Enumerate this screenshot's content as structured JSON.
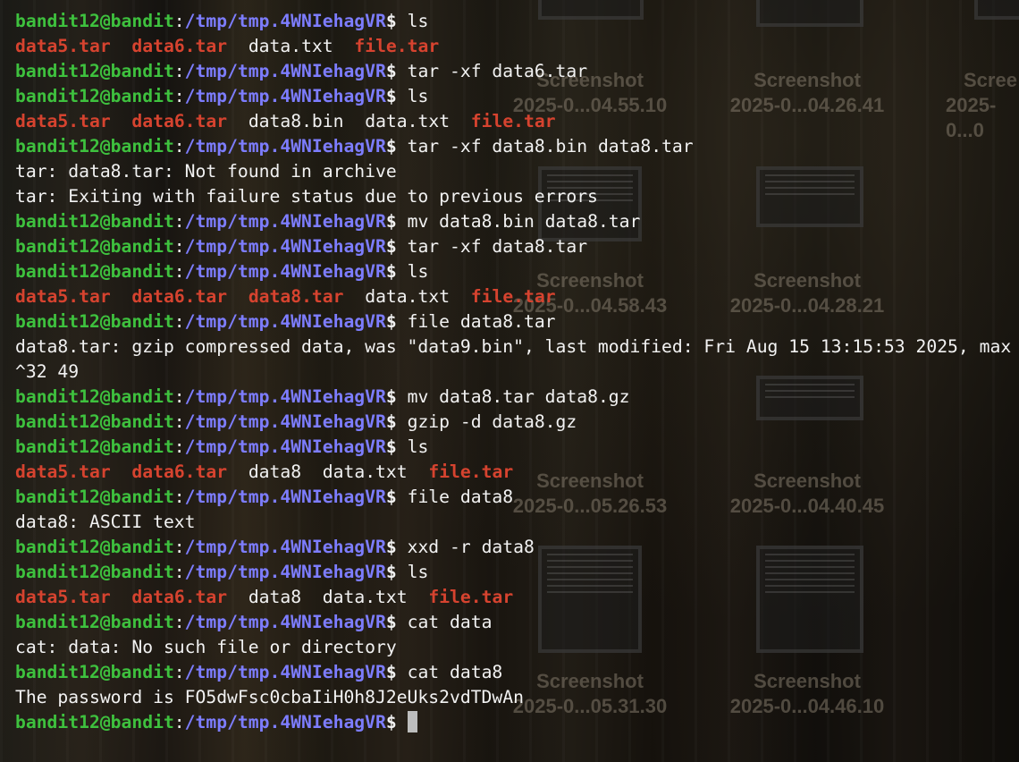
{
  "prompt": {
    "user_host": "bandit12@bandit",
    "sep": ":",
    "path": "/tmp/tmp.4WNIehagVR",
    "dollar": "$ "
  },
  "desktop": {
    "icons": [
      {
        "name": "Screenshot",
        "date": "2025-0...04.55.10"
      },
      {
        "name": "Screenshot",
        "date": "2025-0...04.26.41"
      },
      {
        "name": "Scree",
        "date": "2025-0...0"
      },
      {
        "name": "Screenshot",
        "date": "2025-0...04.58.43"
      },
      {
        "name": "Screenshot",
        "date": "2025-0...04.28.21"
      },
      {
        "name": "Screenshot",
        "date": "2025-0...05.26.53"
      },
      {
        "name": "Screenshot",
        "date": "2025-0...04.40.45"
      },
      {
        "name": "Screenshot",
        "date": "2025-0...05.31.30"
      },
      {
        "name": "Screenshot",
        "date": "2025-0...04.46.10"
      }
    ]
  },
  "terminal": {
    "lines": [
      {
        "type": "cmd",
        "text": "ls"
      },
      {
        "type": "ls",
        "items": [
          {
            "t": "data5.tar",
            "c": "red"
          },
          {
            "t": "data6.tar",
            "c": "red"
          },
          {
            "t": "data.txt",
            "c": "out"
          },
          {
            "t": "file.tar",
            "c": "red"
          }
        ]
      },
      {
        "type": "cmd",
        "text": "tar -xf data6.tar"
      },
      {
        "type": "cmd",
        "text": "ls"
      },
      {
        "type": "ls",
        "items": [
          {
            "t": "data5.tar",
            "c": "red"
          },
          {
            "t": "data6.tar",
            "c": "red"
          },
          {
            "t": "data8.bin",
            "c": "out"
          },
          {
            "t": "data.txt",
            "c": "out"
          },
          {
            "t": "file.tar",
            "c": "red"
          }
        ]
      },
      {
        "type": "cmd",
        "text": "tar -xf data8.bin data8.tar"
      },
      {
        "type": "out",
        "text": "tar: data8.tar: Not found in archive"
      },
      {
        "type": "out",
        "text": "tar: Exiting with failure status due to previous errors"
      },
      {
        "type": "cmd",
        "text": "mv data8.bin data8.tar"
      },
      {
        "type": "cmd",
        "text": "tar -xf data8.tar"
      },
      {
        "type": "cmd",
        "text": "ls"
      },
      {
        "type": "ls",
        "items": [
          {
            "t": "data5.tar",
            "c": "red"
          },
          {
            "t": "data6.tar",
            "c": "red"
          },
          {
            "t": "data8.tar",
            "c": "red"
          },
          {
            "t": "data.txt",
            "c": "out"
          },
          {
            "t": "file.tar",
            "c": "red"
          }
        ]
      },
      {
        "type": "cmd",
        "text": "file data8.tar"
      },
      {
        "type": "out",
        "text": "data8.tar: gzip compressed data, was \"data9.bin\", last modified: Fri Aug 15 13:15:53 2025, max"
      },
      {
        "type": "out",
        "text": "^32 49"
      },
      {
        "type": "cmd",
        "text": "mv data8.tar data8.gz"
      },
      {
        "type": "cmd",
        "text": "gzip -d data8.gz"
      },
      {
        "type": "cmd",
        "text": "ls"
      },
      {
        "type": "ls",
        "items": [
          {
            "t": "data5.tar",
            "c": "red"
          },
          {
            "t": "data6.tar",
            "c": "red"
          },
          {
            "t": "data8",
            "c": "out"
          },
          {
            "t": "data.txt",
            "c": "out"
          },
          {
            "t": "file.tar",
            "c": "red"
          }
        ]
      },
      {
        "type": "cmd",
        "text": "file data8"
      },
      {
        "type": "out",
        "text": "data8: ASCII text"
      },
      {
        "type": "cmd",
        "text": "xxd -r data8"
      },
      {
        "type": "cmd",
        "text": "ls"
      },
      {
        "type": "ls",
        "items": [
          {
            "t": "data5.tar",
            "c": "red"
          },
          {
            "t": "data6.tar",
            "c": "red"
          },
          {
            "t": "data8",
            "c": "out"
          },
          {
            "t": "data.txt",
            "c": "out"
          },
          {
            "t": "file.tar",
            "c": "red"
          }
        ]
      },
      {
        "type": "cmd",
        "text": "cat data"
      },
      {
        "type": "out",
        "text": "cat: data: No such file or directory"
      },
      {
        "type": "cmd",
        "text": "cat data8"
      },
      {
        "type": "out",
        "text": "The password is FO5dwFsc0cbaIiH0h8J2eUks2vdTDwAn"
      },
      {
        "type": "cursor",
        "text": ""
      }
    ]
  }
}
